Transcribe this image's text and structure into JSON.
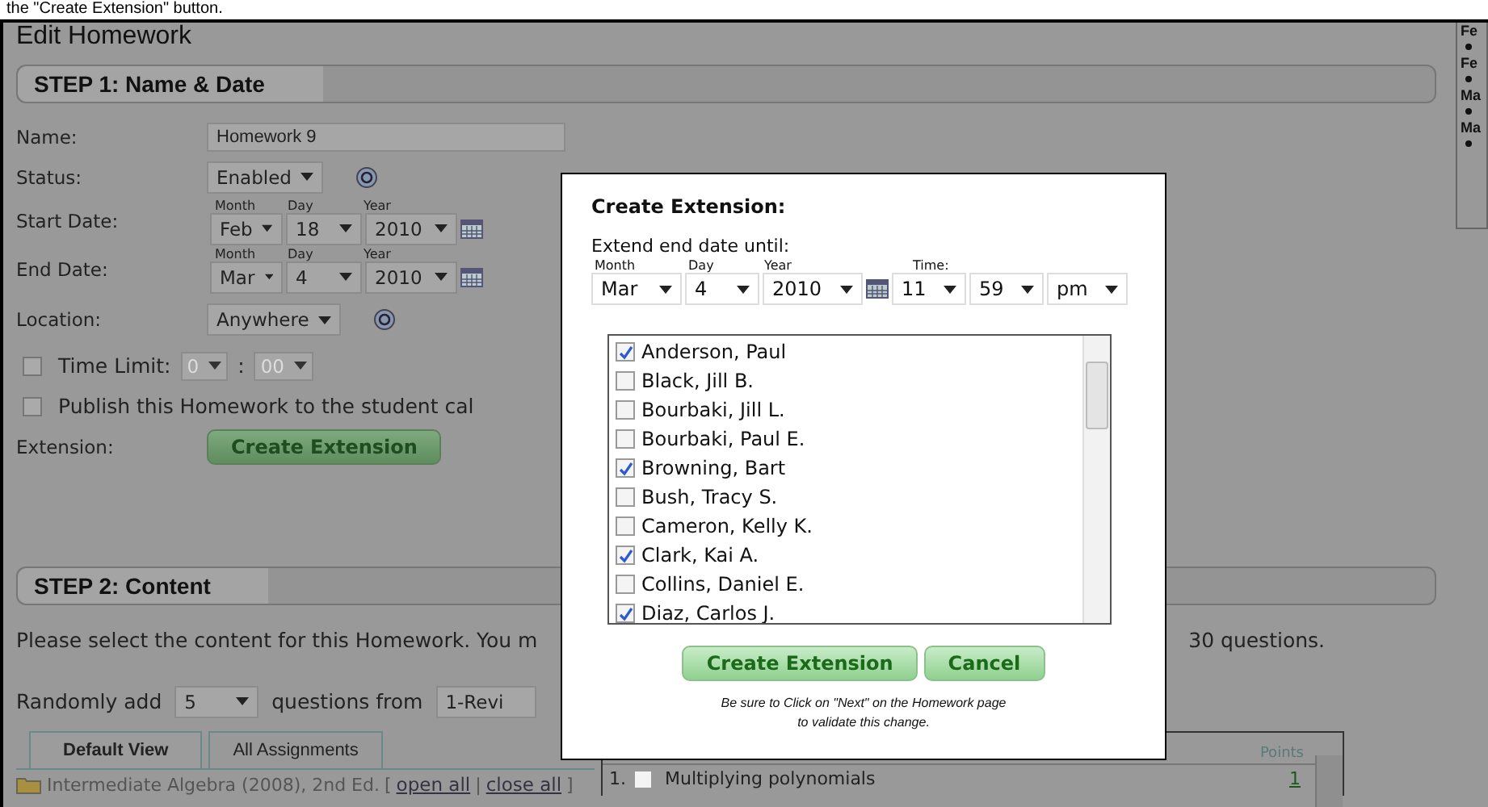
{
  "caption": "the \"Create Extension\" button.",
  "page_title": "Edit Homework",
  "step1": {
    "title": "STEP 1: Name & Date",
    "name": {
      "label": "Name:",
      "value": "Homework 9"
    },
    "status": {
      "label": "Status:",
      "value": "Enabled"
    },
    "dates": [
      {
        "label": "Start Date:",
        "month_label": "Month",
        "day_label": "Day",
        "year_label": "Year",
        "month": "Feb",
        "day": "18",
        "year": "2010"
      },
      {
        "label": "End Date:",
        "month_label": "Month",
        "day_label": "Day",
        "year_label": "Year",
        "month": "Mar",
        "day": "4",
        "year": "2010"
      }
    ],
    "location": {
      "label": "Location:",
      "value": "Anywhere"
    },
    "time_limit": {
      "label": "Time Limit:",
      "checked": false,
      "hours": "0",
      "separator": ":",
      "minutes": "00"
    },
    "publish": {
      "label": "Publish this Homework to the student cal",
      "checked": false
    },
    "extension": {
      "label": "Extension:",
      "button": "Create Extension"
    }
  },
  "step2": {
    "title": "STEP 2: Content",
    "intro": "Please select the content for this Homework. You m",
    "intro_end": "30 questions.",
    "random": {
      "prefix": "Randomly add",
      "count": "5",
      "middle": "questions from",
      "source": "1-Revi"
    },
    "tabs": [
      {
        "label": "Default View",
        "selected": true
      },
      {
        "label": "All Assignments",
        "selected": false
      }
    ],
    "tree_root": "Intermediate Algebra (2008), 2nd Ed.",
    "tree_links": [
      {
        "kind": "text",
        "text": "["
      },
      {
        "kind": "link",
        "text": "open all"
      },
      {
        "kind": "text",
        "text": "|"
      },
      {
        "kind": "link",
        "text": "close all"
      },
      {
        "kind": "text",
        "text": "]"
      }
    ],
    "points_header": "Points",
    "questions": [
      {
        "number": "1.",
        "title": "Multiplying polynomials",
        "checked": false,
        "points": "1"
      }
    ]
  },
  "sidebar": {
    "items": [
      {
        "heading": "Fe"
      },
      {
        "heading": "Fe"
      },
      {
        "heading": "Ma"
      },
      {
        "heading": "Ma"
      }
    ]
  },
  "dialog": {
    "title": "Create Extension:",
    "intro": "Extend end date until:",
    "month_label": "Month",
    "day_label": "Day",
    "year_label": "Year",
    "time_label": "Time:",
    "month": "Mar",
    "day": "4",
    "year": "2010",
    "hour": "11",
    "minute": "59",
    "ampm": "pm",
    "students": [
      {
        "name": "Anderson, Paul",
        "checked": true
      },
      {
        "name": "Black, Jill B.",
        "checked": false
      },
      {
        "name": "Bourbaki, Jill L.",
        "checked": false
      },
      {
        "name": "Bourbaki, Paul E.",
        "checked": false
      },
      {
        "name": "Browning, Bart",
        "checked": true
      },
      {
        "name": "Bush, Tracy S.",
        "checked": false
      },
      {
        "name": "Cameron, Kelly K.",
        "checked": false
      },
      {
        "name": "Clark, Kai A.",
        "checked": true
      },
      {
        "name": "Collins, Daniel E.",
        "checked": false
      },
      {
        "name": "Diaz, Carlos J.",
        "checked": true
      }
    ],
    "buttons": [
      "Create Extension",
      "Cancel"
    ],
    "note": [
      "Be sure to Click on \"Next\" on the Homework page",
      "to validate this change."
    ]
  }
}
